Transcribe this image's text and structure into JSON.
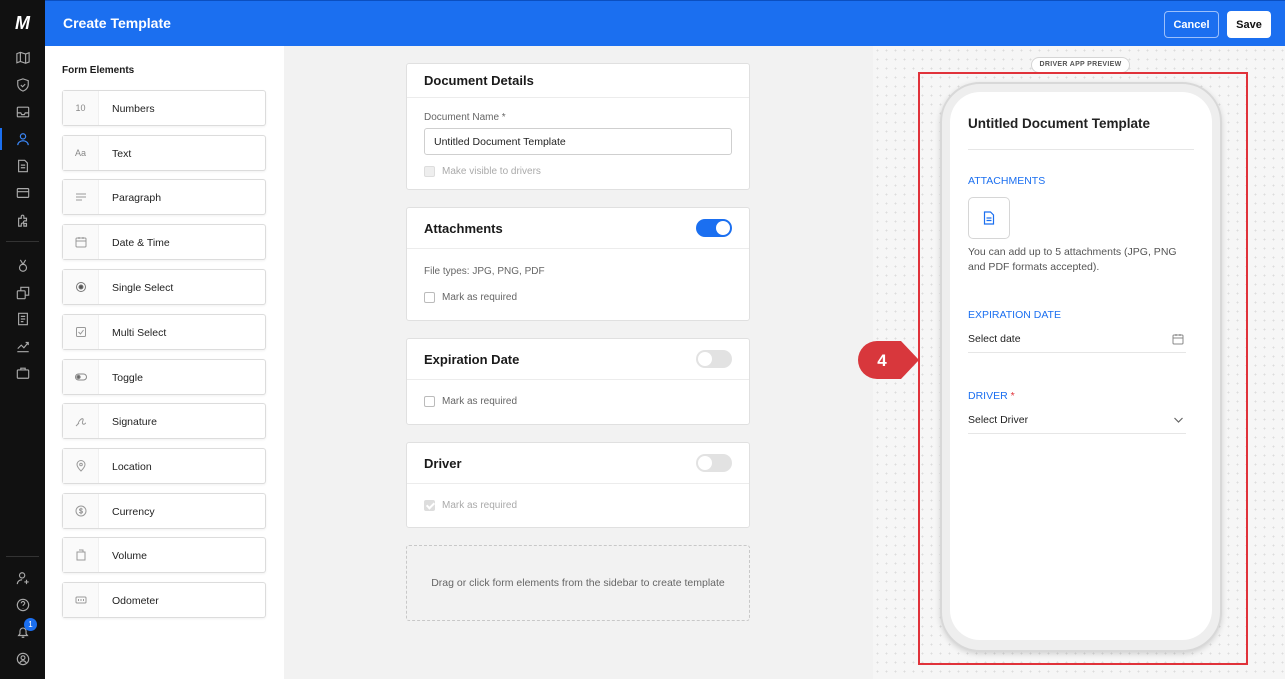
{
  "header": {
    "title": "Create Template",
    "cancel_label": "Cancel",
    "save_label": "Save"
  },
  "rail": {
    "logo": "M",
    "notification_count": "1"
  },
  "sidebar": {
    "title": "Form Elements",
    "items": [
      {
        "icon_text": "10",
        "label": "Numbers"
      },
      {
        "icon_text": "Aa",
        "label": "Text"
      },
      {
        "icon": "paragraph-icon",
        "label": "Paragraph"
      },
      {
        "icon": "calendar-icon",
        "label": "Date & Time"
      },
      {
        "icon": "radio-icon",
        "label": "Single Select"
      },
      {
        "icon": "checkbox-icon",
        "label": "Multi Select"
      },
      {
        "icon": "toggle-icon",
        "label": "Toggle"
      },
      {
        "icon": "signature-icon",
        "label": "Signature"
      },
      {
        "icon": "location-pin-icon",
        "label": "Location"
      },
      {
        "icon": "dollar-icon",
        "label": "Currency"
      },
      {
        "icon": "volume-icon",
        "label": "Volume"
      },
      {
        "icon": "odometer-icon",
        "label": "Odometer"
      }
    ]
  },
  "canvas": {
    "document_details": {
      "title": "Document Details",
      "name_label": "Document Name *",
      "name_value": "Untitled Document Template",
      "visible_label": "Make visible to drivers"
    },
    "attachments": {
      "title": "Attachments",
      "toggle_on": true,
      "file_types": "File types: JPG, PNG, PDF",
      "required_label": "Mark as required"
    },
    "expiration": {
      "title": "Expiration Date",
      "toggle_on": false,
      "required_label": "Mark as required"
    },
    "driver": {
      "title": "Driver",
      "toggle_on": false,
      "required_label": "Mark as required"
    },
    "dropzone_text": "Drag or click form elements from the sidebar to create template"
  },
  "preview": {
    "label": "DRIVER APP PREVIEW",
    "doc_title": "Untitled Document Template",
    "attachments_heading": "ATTACHMENTS",
    "attachments_help": "You can add up to 5 attachments (JPG, PNG and PDF formats accepted).",
    "expiration_heading": "EXPIRATION DATE",
    "expiration_placeholder": "Select date",
    "driver_heading": "DRIVER",
    "driver_required_mark": "*",
    "driver_placeholder": "Select Driver"
  },
  "callout": {
    "number": "4",
    "color": "#d8373c"
  },
  "colors": {
    "brand": "#1b6ff0",
    "highlight": "#e0323a"
  }
}
